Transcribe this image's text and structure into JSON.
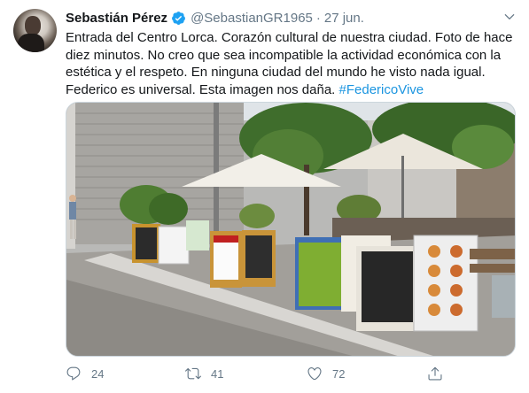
{
  "tweet": {
    "author_name": "Sebastián Pérez",
    "handle": "@SebastianGR1965",
    "separator": "·",
    "date": "27 jun.",
    "text_main": "Entrada del Centro Lorca. Corazón cultural de nuestra ciudad. Foto de hace diez minutos. No creo que sea incompatible la actividad económica con la estética y el respeto. En ninguna ciudad del mundo he visto nada igual. Federico es universal. Esta imagen nos daña.",
    "hashtag": "#FedericoVive"
  },
  "actions": {
    "reply_count": "24",
    "retweet_count": "41",
    "like_count": "72"
  },
  "icons": {
    "verified": "verified-badge-icon",
    "caret": "chevron-down-icon",
    "reply": "reply-icon",
    "retweet": "retweet-icon",
    "like": "heart-icon",
    "share": "share-icon"
  },
  "colors": {
    "text": "#14171a",
    "secondary": "#657786",
    "link": "#1b95e0",
    "verified": "#1da1f2"
  }
}
